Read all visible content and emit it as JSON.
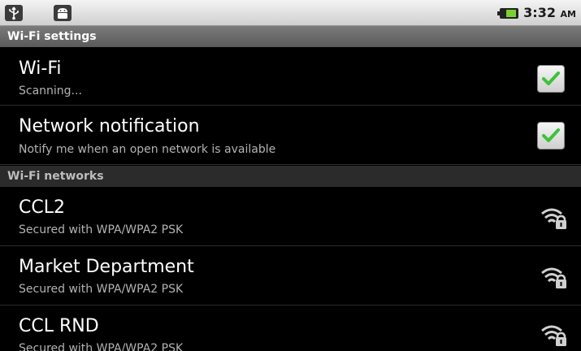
{
  "statusbar": {
    "usb_icon": "usb-icon",
    "android_icon": "android-debug-icon",
    "time": "3:32",
    "ampm": "AM",
    "battery_color": "#7bd130"
  },
  "sections": {
    "settings_header": "Wi-Fi settings",
    "networks_header": "Wi-Fi networks"
  },
  "settings": [
    {
      "title": "Wi-Fi",
      "subtitle": "Scanning...",
      "checked": true
    },
    {
      "title": "Network notification",
      "subtitle": "Notify me when an open network is available",
      "checked": true
    }
  ],
  "networks": [
    {
      "name": "CCL2",
      "security": "Secured with WPA/WPA2 PSK",
      "icon": "wifi-lock-icon"
    },
    {
      "name": "Market Department",
      "security": "Secured with WPA/WPA2 PSK",
      "icon": "wifi-lock-icon"
    },
    {
      "name": "CCL RND",
      "security": "Secured with WPA/WPA2 PSK",
      "icon": "wifi-lock-icon"
    }
  ],
  "colors": {
    "check_green": "#3cc23c",
    "header_bg": "#6b6b6b",
    "background": "#000000"
  }
}
